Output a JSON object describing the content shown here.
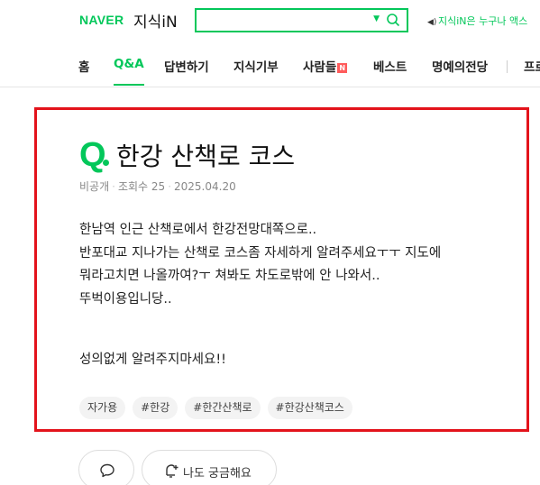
{
  "header": {
    "logo": "NAVER",
    "service": "지식iN",
    "search": {
      "value": "",
      "placeholder": ""
    },
    "notice": "지식iN은 누구나 액스"
  },
  "nav": {
    "items": [
      {
        "label": "홈"
      },
      {
        "label": "Q&A",
        "active": true
      },
      {
        "label": "답변하기"
      },
      {
        "label": "지식기부"
      },
      {
        "label": "사람들",
        "badge": "N"
      },
      {
        "label": "베스트"
      },
      {
        "label": "명예의전당"
      },
      {
        "label": "프로"
      }
    ]
  },
  "question": {
    "q_mark": "Q",
    "title": "한강 산책로 코스",
    "author": "비공개",
    "views_label": "조회수",
    "views": "25",
    "date": "2025.04.20",
    "body": "한남역 인근 산책로에서 한강전망대쪽으로..\n반포대교 지나가는 산책로 코스좀 자세하게 알려주세요ㅜㅜ 지도에\n뭐라고치면 나올까여?ㅜ 쳐봐도 차도로밖에 안 나와서..\n뚜벅이용입니당..",
    "closing": "성의없게 알려주지마세요!!",
    "tags": [
      "자가용",
      "#한강",
      "#한간산책로",
      "#한강산책코스"
    ]
  },
  "actions": {
    "curious_label": "나도 궁금해요"
  },
  "colors": {
    "brand": "#03c75a",
    "highlight_border": "#e3131b",
    "badge": "#ff5b5b"
  },
  "icons": [
    "search-icon",
    "dropdown-caret-icon",
    "speaker-icon",
    "comment-icon",
    "curious-plus-icon"
  ]
}
